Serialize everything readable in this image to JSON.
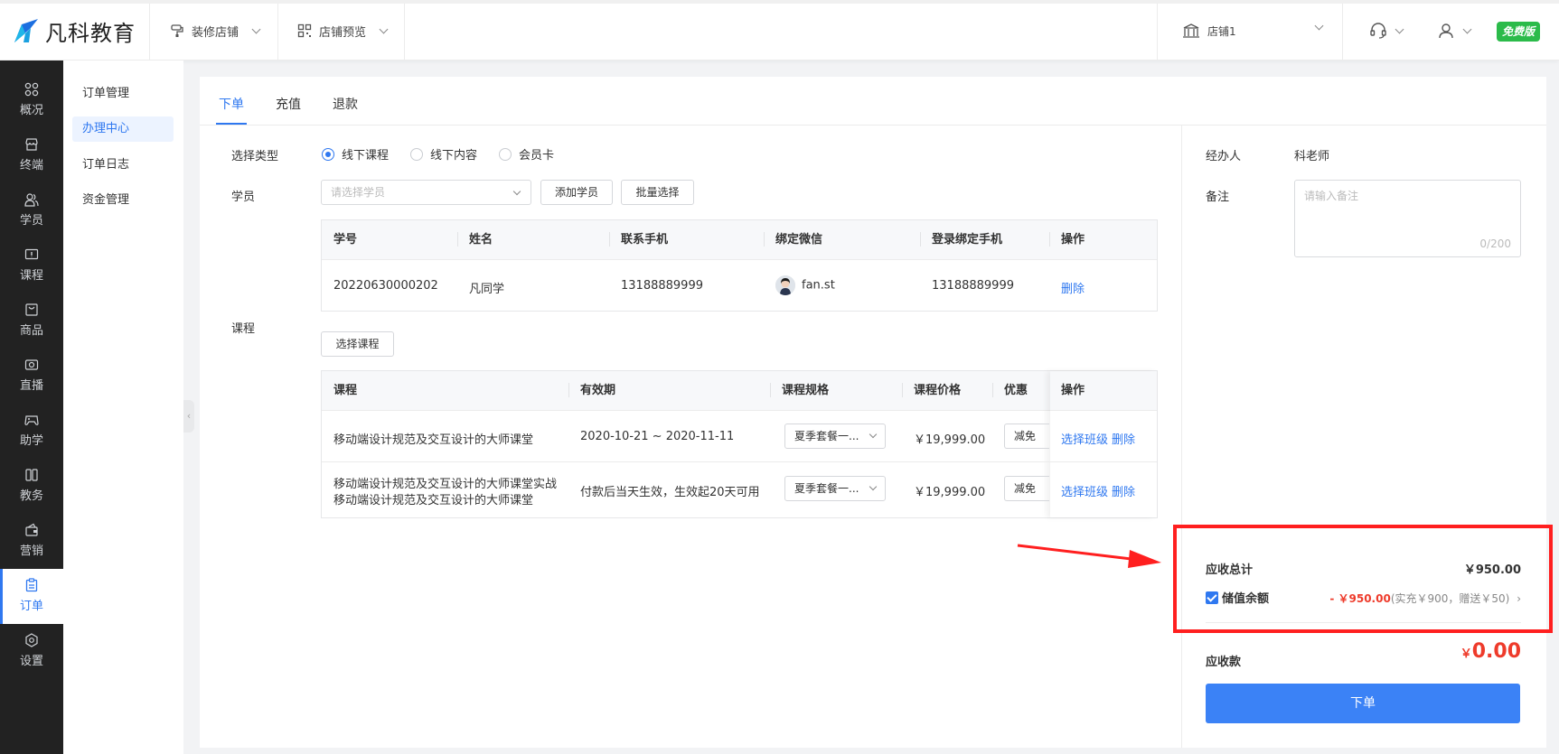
{
  "header": {
    "logo_text": "凡科教育",
    "nav": [
      {
        "label": "装修店铺",
        "icon": "brush-icon"
      },
      {
        "label": "店铺预览",
        "icon": "qrcode-icon"
      }
    ],
    "store": {
      "label": "店铺1",
      "icon": "store-icon"
    },
    "support_icon": "headset-icon",
    "user_icon": "user-icon",
    "plan_badge": "免费版"
  },
  "sidebar": {
    "items": [
      {
        "label": "概况",
        "icon": "grid-icon"
      },
      {
        "label": "终端",
        "icon": "storefront-icon"
      },
      {
        "label": "学员",
        "icon": "people-icon"
      },
      {
        "label": "课程",
        "icon": "course-icon"
      },
      {
        "label": "商品",
        "icon": "bag-icon"
      },
      {
        "label": "直播",
        "icon": "camera-icon"
      },
      {
        "label": "助学",
        "icon": "gamepad-icon"
      },
      {
        "label": "教务",
        "icon": "book-icon"
      },
      {
        "label": "营销",
        "icon": "wallet-icon"
      },
      {
        "label": "订单",
        "icon": "clipboard-icon",
        "active": true
      },
      {
        "label": "设置",
        "icon": "gear-icon"
      }
    ]
  },
  "submenu": {
    "items": [
      "订单管理",
      "办理中心",
      "订单日志",
      "资金管理"
    ],
    "active_index": 1
  },
  "tabs": [
    "下单",
    "充值",
    "退款"
  ],
  "form": {
    "type_label": "选择类型",
    "type_options": [
      "线下课程",
      "线下内容",
      "会员卡"
    ],
    "student_label": "学员",
    "student_placeholder": "请选择学员",
    "add_student_button": "添加学员",
    "batch_select_button": "批量选择",
    "course_label": "课程",
    "select_course_button": "选择课程"
  },
  "student_table": {
    "headers": [
      "学号",
      "姓名",
      "联系手机",
      "绑定微信",
      "登录绑定手机",
      "操作"
    ],
    "rows": [
      {
        "id": "20220630000202",
        "name": "凡同学",
        "phone": "13188889999",
        "wechat": "fan.st",
        "login_phone": "13188889999",
        "action": "删除"
      }
    ]
  },
  "course_table": {
    "headers": [
      "课程",
      "有效期",
      "课程规格",
      "课程价格",
      "优惠",
      "操作"
    ],
    "rows": [
      {
        "course": "移动端设计规范及交互设计的大师课堂",
        "course2": "",
        "validity": "2020-10-21 ~ 2020-11-11",
        "spec": "夏季套餐一...",
        "price": "￥19,999.00",
        "discount": "减免",
        "action1": "选择班级",
        "action2": "删除"
      },
      {
        "course": "移动端设计规范及交互设计的大师课堂实战",
        "course2": "移动端设计规范及交互设计的大师课堂",
        "validity": "付款后当天生效，生效起20天可用",
        "spec": "夏季套餐一...",
        "price": "￥19,999.00",
        "discount": "减免",
        "action1": "选择班级",
        "action2": "删除"
      }
    ]
  },
  "right": {
    "agent_label": "经办人",
    "agent_value": "科老师",
    "remark_label": "备注",
    "remark_placeholder": "请输入备注",
    "remark_count": "0/200",
    "total_label": "应收总计",
    "total_value": "￥950.00",
    "balance_label": "储值余额",
    "balance_value": "- ￥950.00",
    "balance_detail": "(实充￥900，赠送￥50)",
    "due_label": "应收款",
    "due_currency": "￥",
    "due_value": "0.00",
    "submit_button": "下单"
  },
  "colors": {
    "accent": "#2f78f0",
    "danger": "#ff1f1f",
    "badge": "#2bbb4a",
    "sidebar_bg": "#222222"
  }
}
